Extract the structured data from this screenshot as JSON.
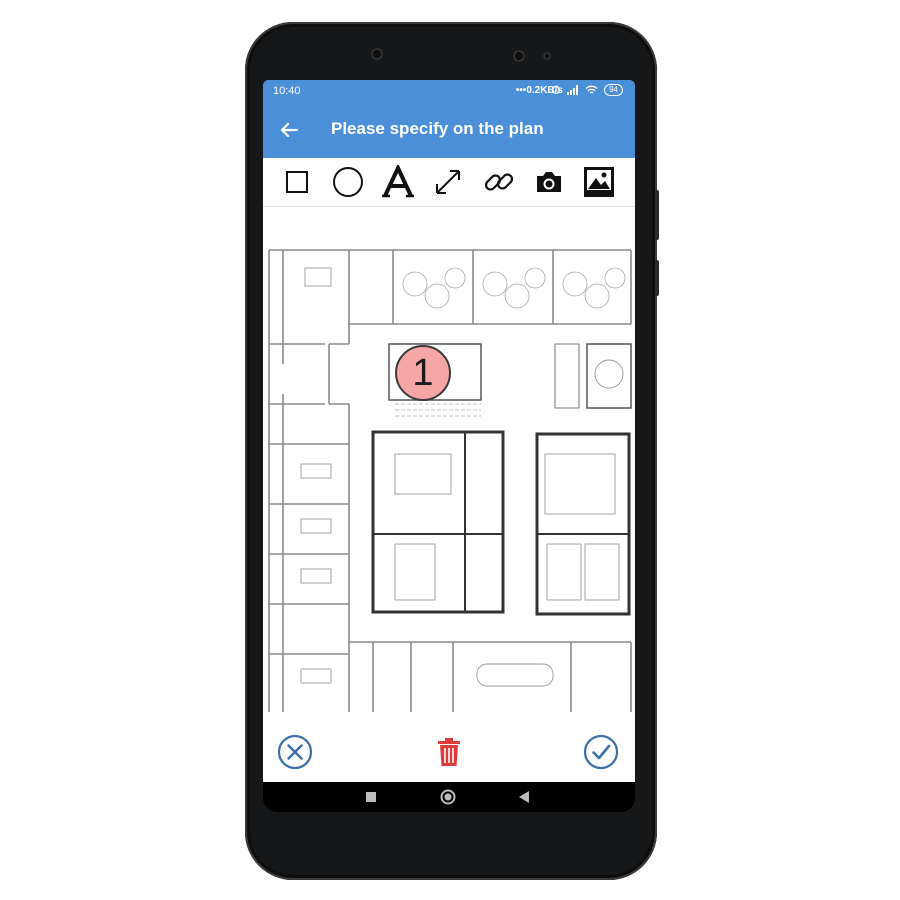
{
  "statusbar": {
    "time": "10:40",
    "network_speed": "0.2KB/s",
    "battery": "94"
  },
  "appbar": {
    "title": "Please specify on the plan",
    "back_icon": "arrow-left-icon"
  },
  "toolbar": {
    "tools": [
      "square-icon",
      "circle-icon",
      "text-icon",
      "resize-arrow-icon",
      "link-icon",
      "camera-icon",
      "image-icon"
    ]
  },
  "plan": {
    "marker_label": "1",
    "marker_color": "#f6a6a6"
  },
  "bottombar": {
    "cancel_icon": "close-circle-icon",
    "delete_icon": "trash-icon",
    "confirm_icon": "check-circle-icon"
  },
  "colors": {
    "primary": "#4a8fd8",
    "delete": "#e03c3c",
    "action": "#3c6fa8"
  }
}
